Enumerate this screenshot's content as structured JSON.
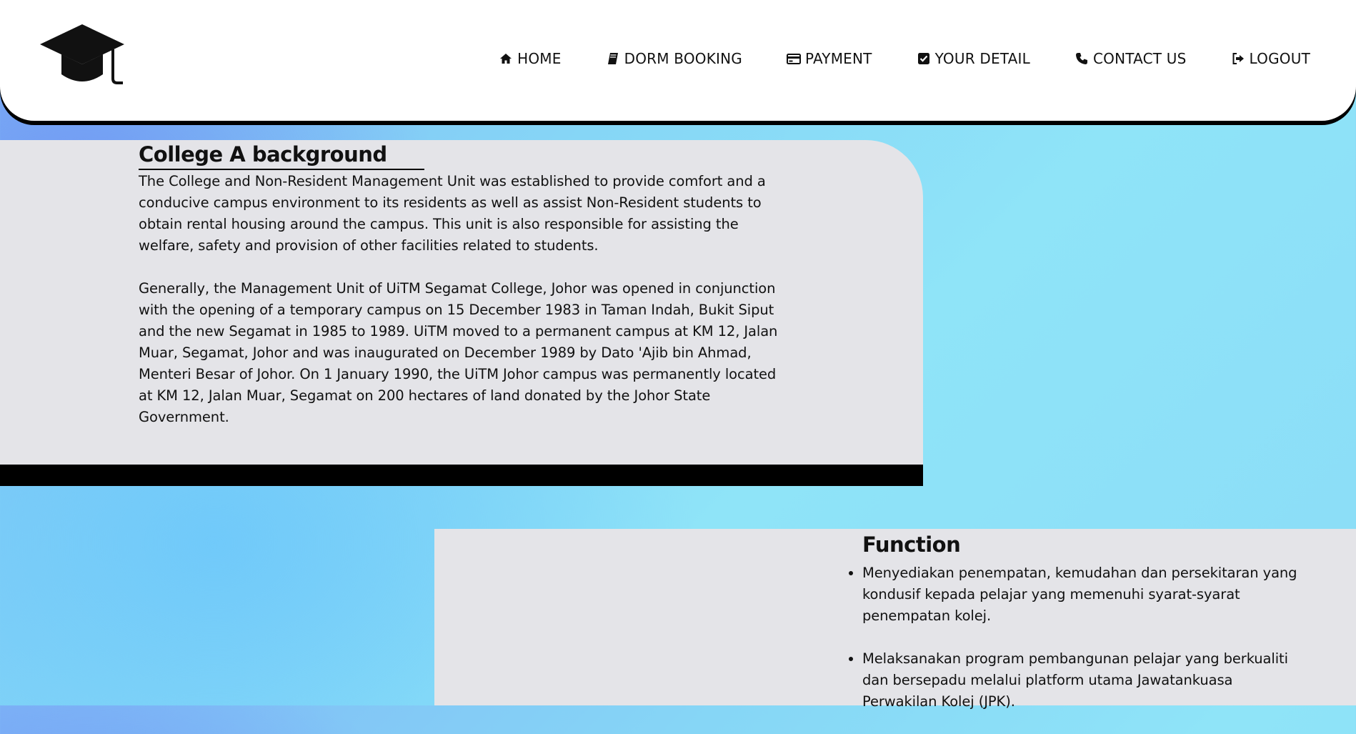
{
  "header": {
    "logo_icon": "graduation-cap-icon",
    "nav": [
      {
        "label": "HOME",
        "icon": "home-icon"
      },
      {
        "label": "DORM BOOKING",
        "icon": "book-icon"
      },
      {
        "label": "PAYMENT",
        "icon": "credit-card-icon"
      },
      {
        "label": "YOUR DETAIL",
        "icon": "check-square-icon"
      },
      {
        "label": "CONTACT US",
        "icon": "phone-icon"
      },
      {
        "label": "LOGOUT",
        "icon": "sign-out-icon"
      }
    ]
  },
  "background_section": {
    "title": "College A background",
    "paragraphs": [
      "The College and Non-Resident Management Unit was established to provide comfort and a conducive campus environment to its residents as well as assist Non-Resident students to obtain rental housing around the campus. This unit is also responsible for assisting the welfare, safety and provision of other facilities related to students.",
      "Generally, the Management Unit of UiTM Segamat College, Johor was opened in conjunction with the opening of a temporary campus on 15 December 1983 in Taman Indah, Bukit Siput and the new Segamat in 1985 to 1989. UiTM moved to a permanent campus at KM 12, Jalan Muar, Segamat, Johor and was inaugurated on December 1989 by Dato 'Ajib bin Ahmad, Menteri Besar of Johor. On 1 January 1990, the UiTM Johor campus was permanently located at KM 12, Jalan Muar, Segamat on 200 hectares of land donated by the Johor State Government."
    ]
  },
  "function_section": {
    "title": "Function",
    "items": [
      "Menyediakan penempatan, kemudahan dan persekitaran yang kondusif kepada pelajar yang memenuhi syarat-syarat penempatan kolej.",
      "Melaksanakan program pembangunan pelajar yang berkualiti dan bersepadu melalui platform utama Jawatankuasa Perwakilan Kolej (JPK)."
    ]
  },
  "colors": {
    "card": "#e4e4e8",
    "navbar": "#ffffff",
    "accent_bar": "#000000",
    "bg_gradient_start": "#7fb8f7",
    "bg_gradient_end": "#8fe4f8"
  }
}
